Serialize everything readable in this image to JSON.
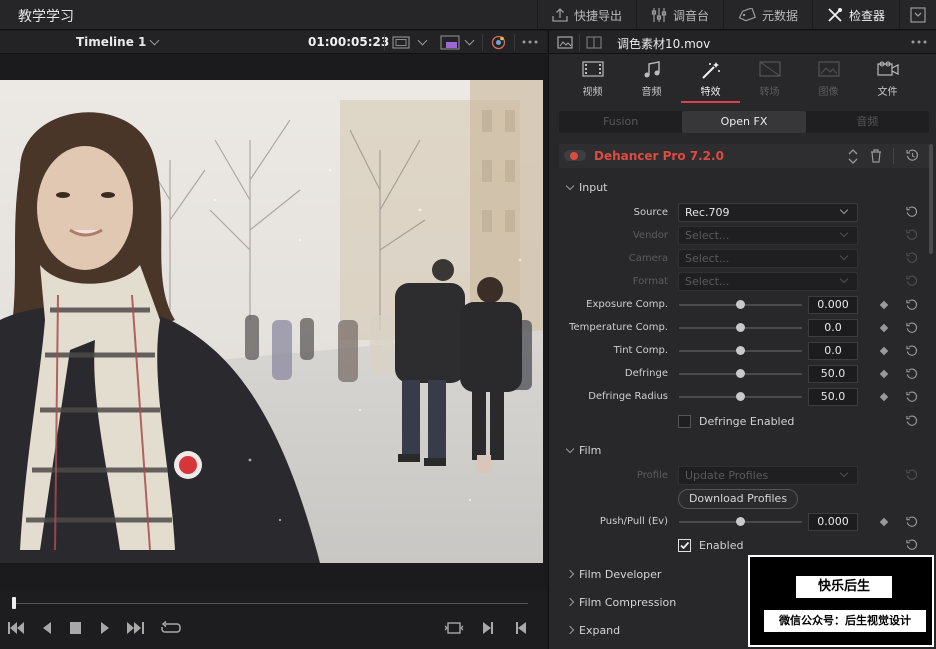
{
  "app": {
    "title": "教学学习"
  },
  "topnav": {
    "export": "快捷导出",
    "mixer": "调音台",
    "metadata": "元数据",
    "inspector": "检查器"
  },
  "viewer": {
    "timeline_name": "Timeline 1",
    "timecode": "01:00:05:23"
  },
  "inspector": {
    "clip_name": "调色素材10.mov",
    "tabs": [
      {
        "label": "视频",
        "icon": "film-strip-icon",
        "state": "normal"
      },
      {
        "label": "音频",
        "icon": "music-note-icon",
        "state": "normal"
      },
      {
        "label": "特效",
        "icon": "magic-wand-icon",
        "state": "active"
      },
      {
        "label": "转场",
        "icon": "transition-icon",
        "state": "dim"
      },
      {
        "label": "图像",
        "icon": "image-icon",
        "state": "dim"
      },
      {
        "label": "文件",
        "icon": "camera-icon",
        "state": "normal"
      }
    ],
    "subtabs": {
      "fusion": "Fusion",
      "openfx": "Open FX",
      "audio": "音频"
    },
    "effect": {
      "name": "Dehancer Pro 7.2.0",
      "input_section": "Input",
      "source": {
        "label": "Source",
        "value": "Rec.709"
      },
      "vendor": {
        "label": "Vendor",
        "value": "Select..."
      },
      "camera": {
        "label": "Camera",
        "value": "Select..."
      },
      "format": {
        "label": "Format",
        "value": "Select..."
      },
      "exposure": {
        "label": "Exposure Comp.",
        "value": "0.000",
        "position": 0.5
      },
      "temperature": {
        "label": "Temperature Comp.",
        "value": "0.0",
        "position": 0.5
      },
      "tint": {
        "label": "Tint Comp.",
        "value": "0.0",
        "position": 0.5
      },
      "defringe": {
        "label": "Defringe",
        "value": "50.0",
        "position": 0.5
      },
      "defringe_radius": {
        "label": "Defringe Radius",
        "value": "50.0",
        "position": 0.5
      },
      "defringe_enabled": {
        "label": "Defringe Enabled",
        "checked": false
      },
      "film_section": "Film",
      "profile": {
        "label": "Profile",
        "value": "Update Profiles"
      },
      "download_button": "Download Profiles",
      "push_pull": {
        "label": "Push/Pull (Ev)",
        "value": "0.000",
        "position": 0.5
      },
      "enabled": {
        "label": "Enabled",
        "checked": true
      },
      "film_developer": "Film Developer",
      "film_compression": "Film Compression",
      "expand": "Expand"
    }
  },
  "watermark": {
    "title": "快乐后生",
    "subtitle": "微信公众号：后生视觉设计"
  },
  "colors": {
    "accent": "#d9414b",
    "effect_title": "#df4a42"
  }
}
